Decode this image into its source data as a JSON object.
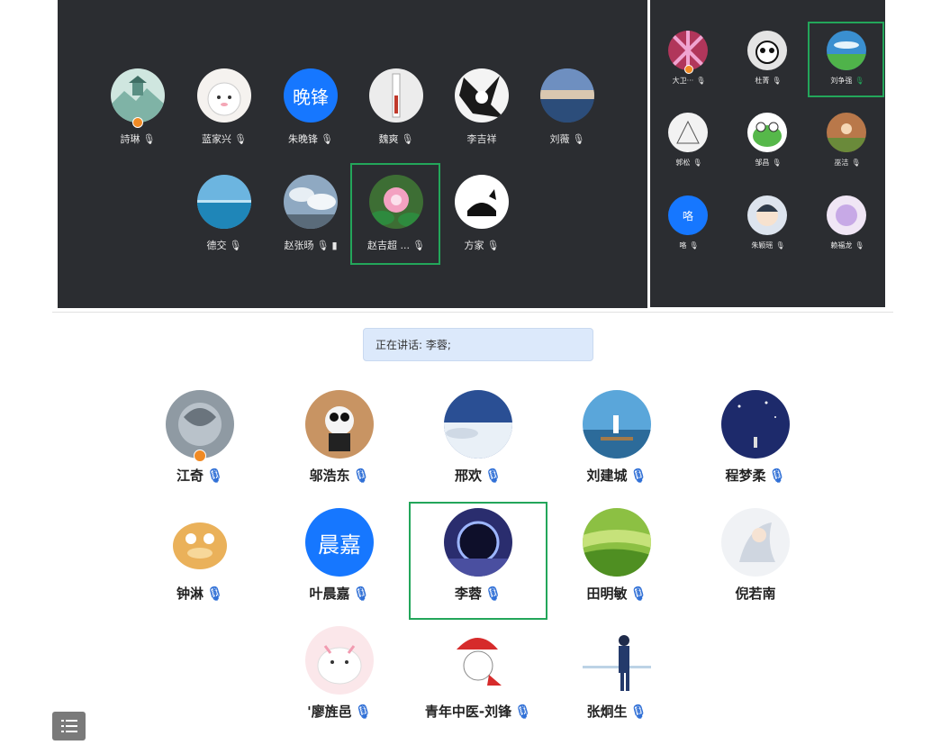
{
  "meeting_grid_1": {
    "row1": [
      {
        "name": "詩琳",
        "host": true
      },
      {
        "name": "蓝家兴"
      },
      {
        "name": "朱晚锋",
        "avatar_text": "晚锋"
      },
      {
        "name": "魏爽"
      },
      {
        "name": "李吉祥"
      },
      {
        "name": "刘薇"
      }
    ],
    "row2": [
      {
        "name": "德交"
      },
      {
        "name": "赵张旸"
      },
      {
        "name": "赵吉超 ...",
        "highlighted": true
      },
      {
        "name": "方家"
      }
    ]
  },
  "meeting_grid_2": {
    "participants": [
      {
        "name": "大卫···",
        "host": true
      },
      {
        "name": "杜菁"
      },
      {
        "name": "刘争强",
        "highlighted": true
      },
      {
        "name": "郭松"
      },
      {
        "name": "邹昌"
      },
      {
        "name": "巫洁"
      },
      {
        "name": "咯",
        "avatar_text": "咯"
      },
      {
        "name": "朱颖瑶"
      },
      {
        "name": "赖福龙"
      }
    ]
  },
  "meeting_grid_3": {
    "speaking_label": "正在讲话: 李蓉;",
    "participants": [
      {
        "name": "江奇",
        "host": true
      },
      {
        "name": "邬浩东"
      },
      {
        "name": "邢欢"
      },
      {
        "name": "刘建城"
      },
      {
        "name": "程梦柔"
      },
      {
        "name": "钟淋"
      },
      {
        "name": "叶晨嘉",
        "avatar_text": "晨嘉"
      },
      {
        "name": "李蓉",
        "highlighted": true
      },
      {
        "name": "田明敏"
      },
      {
        "name": "倪若南"
      },
      {
        "name": "'廖旌邑"
      },
      {
        "name": "青年中医-刘锋"
      },
      {
        "name": "张炯生"
      }
    ]
  },
  "colors": {
    "panel_dark": "#2b2d31",
    "highlight": "#23a65a",
    "mic_blue": "#2f6fd6",
    "host_badge": "#f08a24",
    "brand_blue": "#1677ff"
  }
}
